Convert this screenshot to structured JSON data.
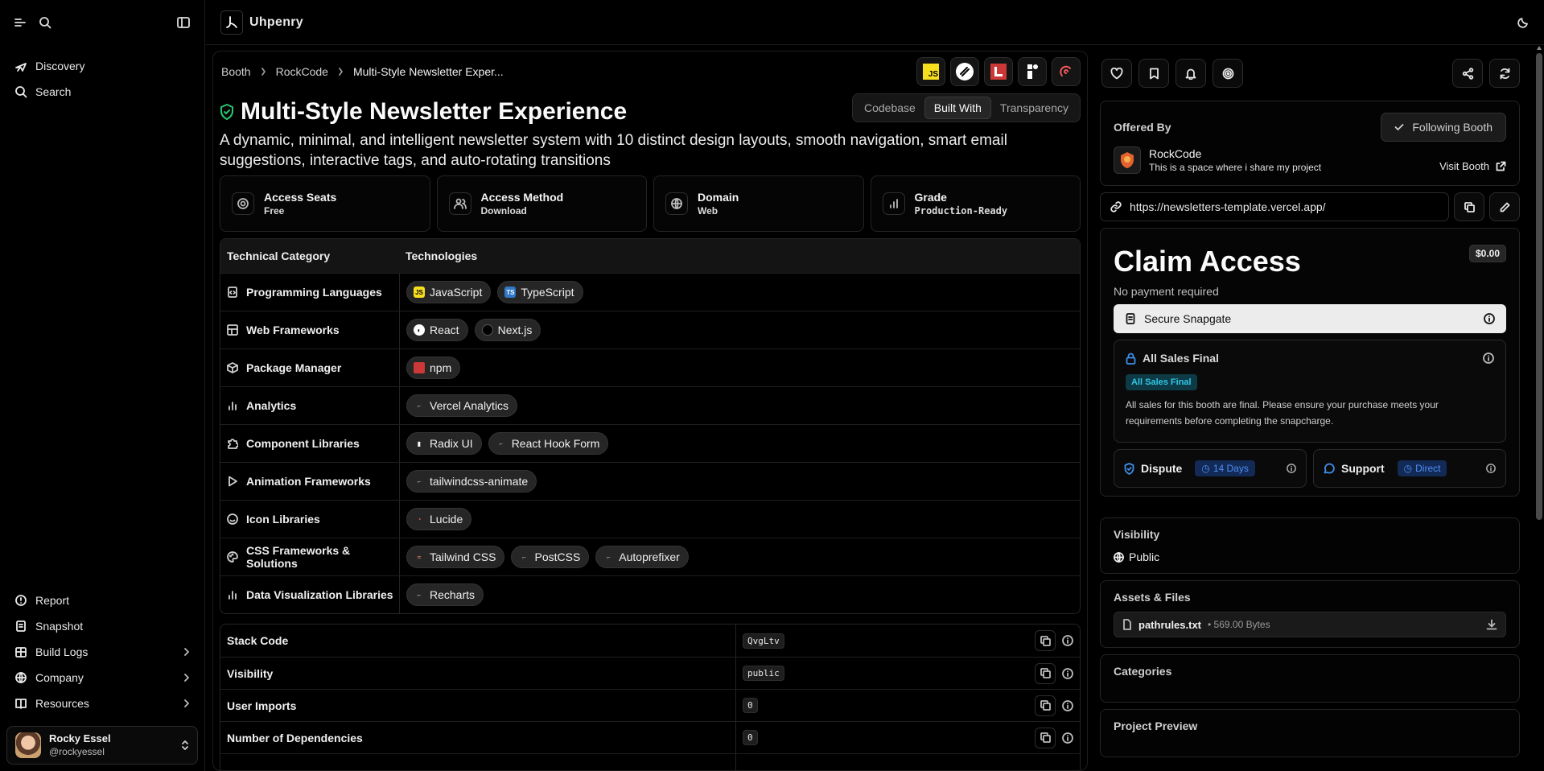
{
  "app": {
    "name": "Uhpenry"
  },
  "sidebar": {
    "nav": [
      {
        "label": "Discovery",
        "icon": "compass-icon"
      },
      {
        "label": "Search",
        "icon": "search-icon"
      }
    ],
    "bottom": [
      {
        "label": "Report",
        "icon": "alert-icon",
        "chevron": false
      },
      {
        "label": "Snapshot",
        "icon": "document-icon",
        "chevron": false
      },
      {
        "label": "Build Logs",
        "icon": "building-icon",
        "chevron": true
      },
      {
        "label": "Company",
        "icon": "globe-icon",
        "chevron": true
      },
      {
        "label": "Resources",
        "icon": "book-icon",
        "chevron": true
      }
    ],
    "user": {
      "name": "Rocky Essel",
      "handle": "@rockyessel"
    }
  },
  "breadcrumb": {
    "items": [
      "Booth",
      "RockCode",
      "Multi-Style Newsletter Exper..."
    ]
  },
  "tech_icons": [
    "javascript-icon",
    "react-icon",
    "npm-icon",
    "radix-icon",
    "lucide-icon"
  ],
  "tabs": [
    "Codebase",
    "Built With",
    "Transparency"
  ],
  "active_tab": "Built With",
  "project": {
    "title": "Multi-Style Newsletter Experience",
    "description": "A dynamic, minimal, and intelligent newsletter system with 10 distinct design layouts, smooth navigation, smart email suggestions, interactive tags, and auto-rotating transitions"
  },
  "cards": [
    {
      "label": "Access Seats",
      "value": "Free"
    },
    {
      "label": "Access Method",
      "value": "Download"
    },
    {
      "label": "Domain",
      "value": "Web"
    },
    {
      "label": "Grade",
      "value": "Production-Ready"
    }
  ],
  "tech_table": {
    "headers": [
      "Technical Category",
      "Technologies"
    ],
    "rows": [
      {
        "category": "Programming Languages",
        "techs": [
          "JavaScript",
          "TypeScript"
        ]
      },
      {
        "category": "Web Frameworks",
        "techs": [
          "React",
          "Next.js"
        ]
      },
      {
        "category": "Package Manager",
        "techs": [
          "npm"
        ]
      },
      {
        "category": "Analytics",
        "techs": [
          "Vercel Analytics"
        ]
      },
      {
        "category": "Component Libraries",
        "techs": [
          "Radix UI",
          "React Hook Form"
        ]
      },
      {
        "category": "Animation Frameworks",
        "techs": [
          "tailwindcss-animate"
        ]
      },
      {
        "category": "Icon Libraries",
        "techs": [
          "Lucide"
        ]
      },
      {
        "category": "CSS Frameworks & Solutions",
        "techs": [
          "Tailwind CSS",
          "PostCSS",
          "Autoprefixer"
        ]
      },
      {
        "category": "Data Visualization Libraries",
        "techs": [
          "Recharts"
        ]
      }
    ]
  },
  "stats_table": {
    "rows": [
      {
        "label": "Stack Code",
        "value": "QvgLtv"
      },
      {
        "label": "Visibility",
        "value": "public"
      },
      {
        "label": "User Imports",
        "value": "0"
      },
      {
        "label": "Number of Dependencies",
        "value": "0"
      }
    ]
  },
  "right": {
    "offered_by": "Offered By",
    "follow_label": "Following Booth",
    "org_name": "RockCode",
    "org_desc": "This is a space where i share my project",
    "visit_label": "Visit Booth",
    "url": "https://newsletters-template.vercel.app/",
    "claim": {
      "title": "Claim Access",
      "price": "$0.00",
      "subtitle": "No payment required",
      "snap_label": "Secure Snapgate"
    },
    "final": {
      "title": "All Sales Final",
      "badge": "All Sales Final",
      "text": "All sales for this booth are final. Please ensure your purchase meets your requirements before completing the snapcharge."
    },
    "dispute": {
      "label": "Dispute",
      "badge": "14 Days"
    },
    "support": {
      "label": "Support",
      "badge": "Direct"
    },
    "visibility": {
      "title": "Visibility",
      "value": "Public"
    },
    "assets": {
      "title": "Assets & Files",
      "file_name": "pathrules.txt",
      "file_size": "• 569.00 Bytes"
    },
    "categories": {
      "title": "Categories"
    },
    "preview": {
      "title": "Project Preview"
    }
  }
}
